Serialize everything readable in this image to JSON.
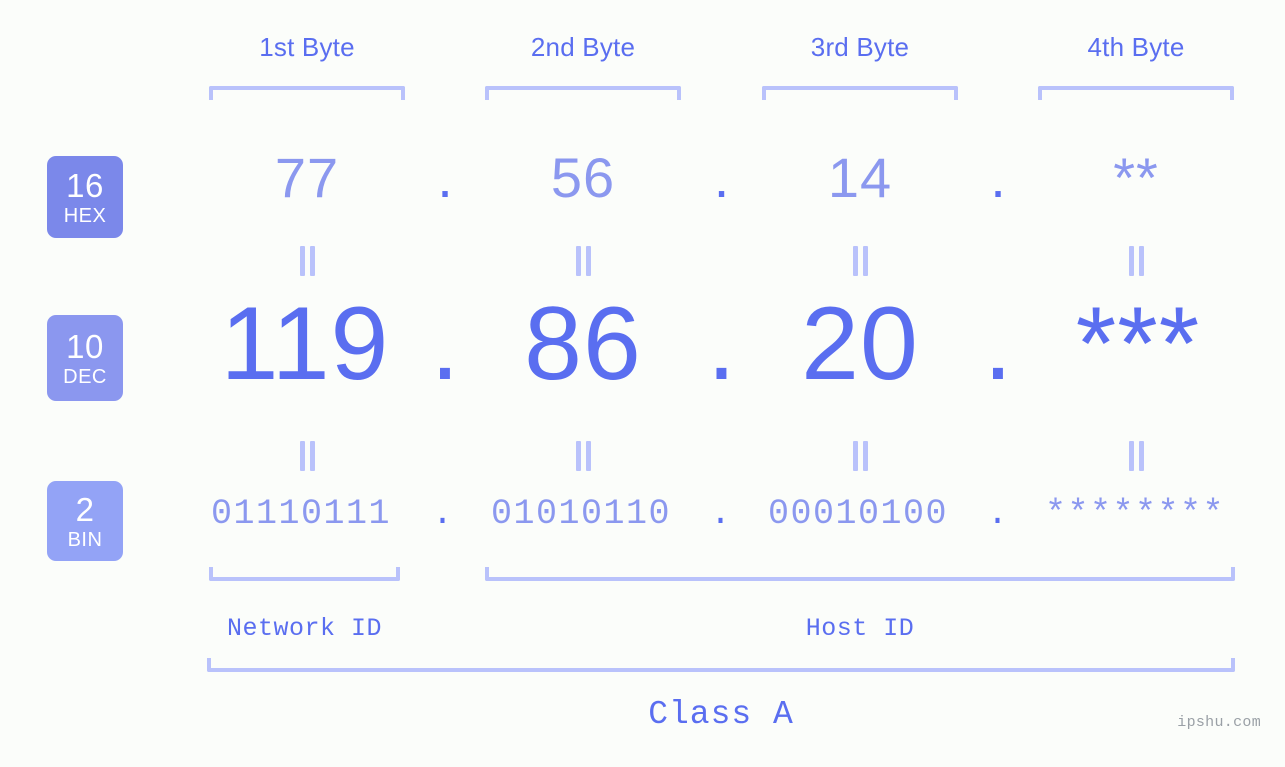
{
  "background_color": "#fbfdfa",
  "accent_color": "#5a6ef0",
  "accent_light_color": "#8b98ef",
  "bracket_color": "#b9c2fb",
  "headers": {
    "byte1": "1st Byte",
    "byte2": "2nd Byte",
    "byte3": "3rd Byte",
    "byte4": "4th Byte"
  },
  "bases": [
    {
      "number": "16",
      "name": "HEX",
      "badge_color": "#7b88ea"
    },
    {
      "number": "10",
      "name": "DEC",
      "badge_color": "#8b97ef"
    },
    {
      "number": "2",
      "name": "BIN",
      "badge_color": "#93a3f6"
    }
  ],
  "rows": {
    "hex": {
      "label_number": "16",
      "label_name": "HEX",
      "values": [
        "77",
        "56",
        "14",
        "**"
      ],
      "separators": [
        ".",
        ".",
        "."
      ]
    },
    "dec": {
      "label_number": "10",
      "label_name": "DEC",
      "values": [
        "119",
        "86",
        "20",
        "***"
      ],
      "separators": [
        ".",
        ".",
        "."
      ]
    },
    "bin": {
      "label_number": "2",
      "label_name": "BIN",
      "values": [
        "01110111",
        "01010110",
        "00010100",
        "********"
      ],
      "separators": [
        ".",
        ".",
        "."
      ]
    }
  },
  "equals_symbol": "=",
  "footer": {
    "network_id": "Network ID",
    "host_id": "Host ID",
    "class": "Class A",
    "watermark": "ipshu.com"
  }
}
